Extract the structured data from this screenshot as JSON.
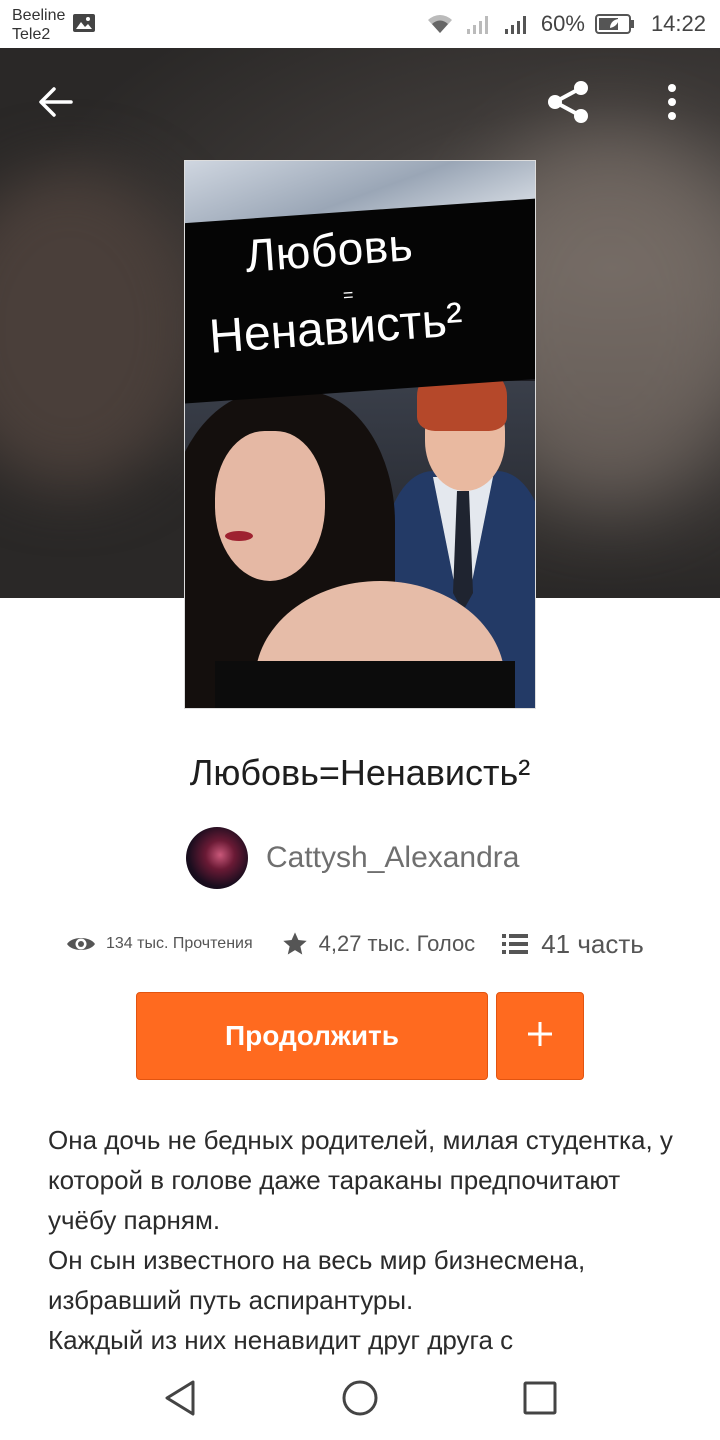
{
  "status_bar": {
    "carrier1": "Beeline",
    "carrier2": "Tele2",
    "battery": "60%",
    "time": "14:22",
    "icons": [
      "gallery-icon",
      "wifi-icon",
      "signal-icon",
      "signal-icon",
      "battery-icon"
    ]
  },
  "header": {
    "icons": [
      "back-arrow-icon",
      "share-icon",
      "more-vert-icon"
    ]
  },
  "cover": {
    "line1": "Любовь",
    "line2": "Ненависть²"
  },
  "book": {
    "title": "Любовь=Ненависть²",
    "author": "Cattysh_Alexandra"
  },
  "stats": {
    "reads": "134 тыс. Прочтения",
    "votes": "4,27 тыс. Голос",
    "parts": "41 часть"
  },
  "actions": {
    "continue_label": "Продолжить",
    "add_label": "+"
  },
  "description": {
    "lines": [
      "Она дочь не бедных родителей, милая студентка, у которой в голове даже тараканы предпочитают учёбу парням.",
      "Он сын известного на весь мир бизнесмена, избравший путь аспирантуры.",
      "Каждый из них ненавидит друг друга с"
    ]
  },
  "colors": {
    "accent": "#ff6a1f",
    "text": "#2b2b2b",
    "muted": "#6f6f6f"
  },
  "navbar": {
    "icons": [
      "nav-back-icon",
      "nav-home-icon",
      "nav-recents-icon"
    ]
  }
}
